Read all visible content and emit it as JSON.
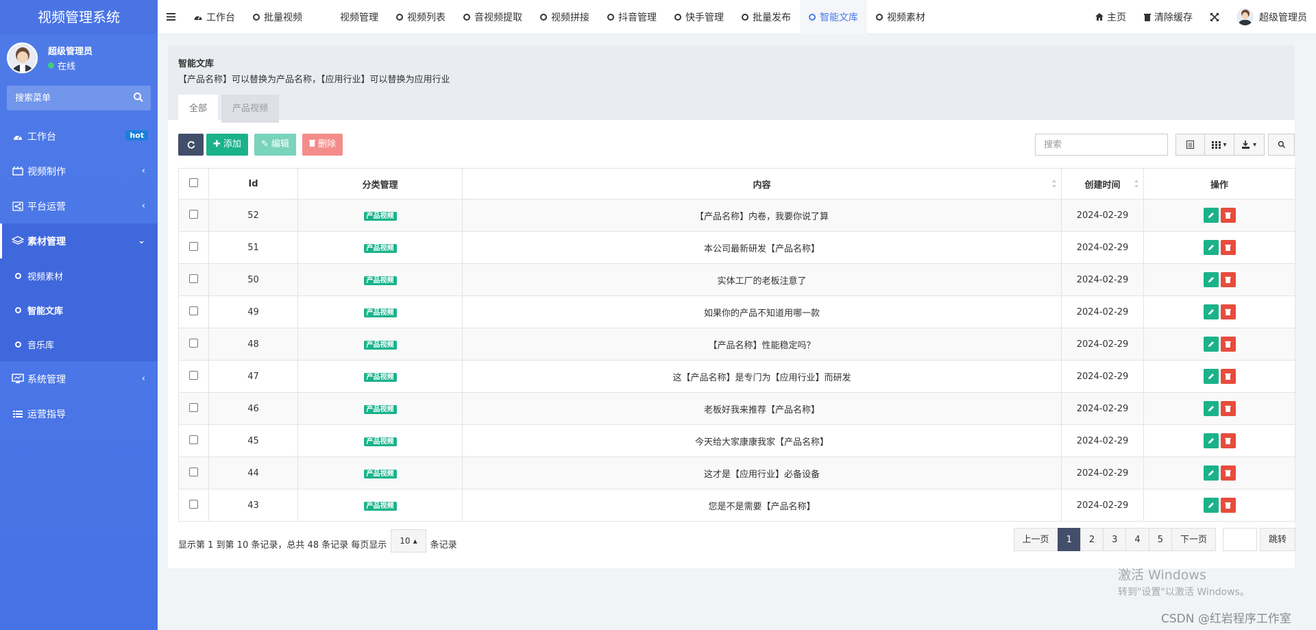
{
  "app": {
    "title": "视频管理系统"
  },
  "user": {
    "name": "超级管理员",
    "status": "在线"
  },
  "sidebar": {
    "search_placeholder": "搜索菜单",
    "items": [
      {
        "label": "工作台",
        "badge": "hot"
      },
      {
        "label": "视频制作"
      },
      {
        "label": "平台运营"
      },
      {
        "label": "素材管理"
      },
      {
        "label": "系统管理"
      },
      {
        "label": "运营指导"
      }
    ],
    "sub_items": [
      {
        "label": "视频素材"
      },
      {
        "label": "智能文库"
      },
      {
        "label": "音乐库"
      }
    ]
  },
  "topnav": {
    "tabs": [
      {
        "label": "工作台"
      },
      {
        "label": "批量视频"
      },
      {
        "label": "视频管理"
      },
      {
        "label": "视频列表"
      },
      {
        "label": "音视频提取"
      },
      {
        "label": "视频拼接"
      },
      {
        "label": "抖音管理"
      },
      {
        "label": "快手管理"
      },
      {
        "label": "批量发布"
      },
      {
        "label": "智能文库"
      },
      {
        "label": "视频素材"
      }
    ],
    "home": "主页",
    "clear_cache": "清除缓存",
    "user": "超级管理员"
  },
  "page": {
    "title": "智能文库",
    "desc": "【产品名称】可以替换为产品名称，【应用行业】可以替换为应用行业",
    "tabs": [
      "全部",
      "产品视频"
    ]
  },
  "toolbar": {
    "add": "添加",
    "edit": "编辑",
    "delete": "删除",
    "search_placeholder": "搜索"
  },
  "table": {
    "headers": [
      "Id",
      "分类管理",
      "内容",
      "创建时间",
      "操作"
    ],
    "rows": [
      {
        "id": "52",
        "category": "产品视频",
        "content": "【产品名称】内卷，我要你说了算",
        "date": "2024-02-29"
      },
      {
        "id": "51",
        "category": "产品视频",
        "content": "本公司最新研发【产品名称】",
        "date": "2024-02-29"
      },
      {
        "id": "50",
        "category": "产品视频",
        "content": "实体工厂的老板注意了",
        "date": "2024-02-29"
      },
      {
        "id": "49",
        "category": "产品视频",
        "content": "如果你的产品不知道用哪一款",
        "date": "2024-02-29"
      },
      {
        "id": "48",
        "category": "产品视频",
        "content": "【产品名称】性能稳定吗？",
        "date": "2024-02-29"
      },
      {
        "id": "47",
        "category": "产品视频",
        "content": "这【产品名称】是专门为【应用行业】而研发",
        "date": "2024-02-29"
      },
      {
        "id": "46",
        "category": "产品视频",
        "content": "老板好我来推荐【产品名称】",
        "date": "2024-02-29"
      },
      {
        "id": "45",
        "category": "产品视频",
        "content": "今天给大家康康我家【产品名称】",
        "date": "2024-02-29"
      },
      {
        "id": "44",
        "category": "产品视频",
        "content": "这才是【应用行业】必备设备",
        "date": "2024-02-29"
      },
      {
        "id": "43",
        "category": "产品视频",
        "content": "您是不是需要【产品名称】",
        "date": "2024-02-29"
      }
    ]
  },
  "footer": {
    "summary": "显示第 1 到第 10 条记录，总共 48 条记录 每页显示",
    "page_size": "10",
    "suffix": "条记录",
    "prev": "上一页",
    "next": "下一页",
    "pages": [
      "1",
      "2",
      "3",
      "4",
      "5"
    ],
    "jump": "跳转"
  },
  "watermark": {
    "line1": "激活 Windows",
    "line2": "转到\"设置\"以激活 Windows。"
  },
  "credit": "CSDN @红岩程序工作室",
  "colors": {
    "sidebar": "#4f7be8",
    "accent": "#4a7ae8",
    "success": "#1bb28a",
    "danger": "#e74c3c",
    "dark": "#434f6a"
  }
}
